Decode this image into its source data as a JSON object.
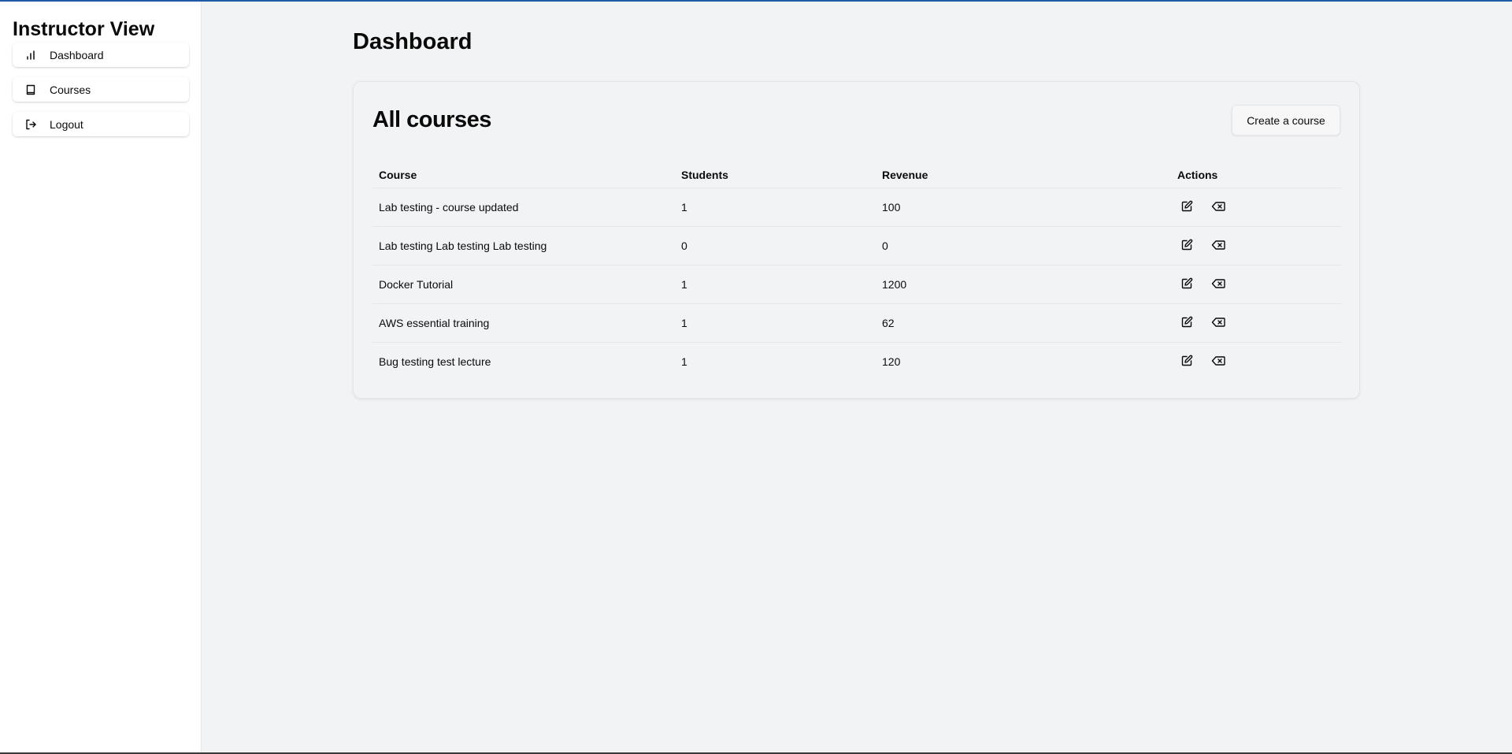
{
  "sidebar": {
    "app_title": "Instructor View",
    "items": [
      {
        "label": "Dashboard",
        "icon": "bar-chart-icon"
      },
      {
        "label": "Courses",
        "icon": "book-icon"
      },
      {
        "label": "Logout",
        "icon": "logout-icon"
      }
    ]
  },
  "main": {
    "page_title": "Dashboard",
    "card": {
      "title": "All courses",
      "create_button_label": "Create a course",
      "table": {
        "headers": [
          "Course",
          "Students",
          "Revenue",
          "Actions"
        ],
        "rows": [
          {
            "course": "Lab testing - course updated",
            "students": "1",
            "revenue": "100"
          },
          {
            "course": "Lab testing Lab testing Lab testing",
            "students": "0",
            "revenue": "0"
          },
          {
            "course": "Docker Tutorial",
            "students": "1",
            "revenue": "1200"
          },
          {
            "course": "AWS essential training",
            "students": "1",
            "revenue": "62"
          },
          {
            "course": "Bug testing test lecture",
            "students": "1",
            "revenue": "120"
          }
        ],
        "row_actions": [
          {
            "icon": "edit-icon"
          },
          {
            "icon": "delete-icon"
          }
        ]
      }
    }
  },
  "colors": {
    "background": "#f2f3f5",
    "sidebar_background": "#ffffff",
    "text": "#0a0a0a",
    "top_accent": "#1f5aa6",
    "border": "#e3e5e8"
  }
}
